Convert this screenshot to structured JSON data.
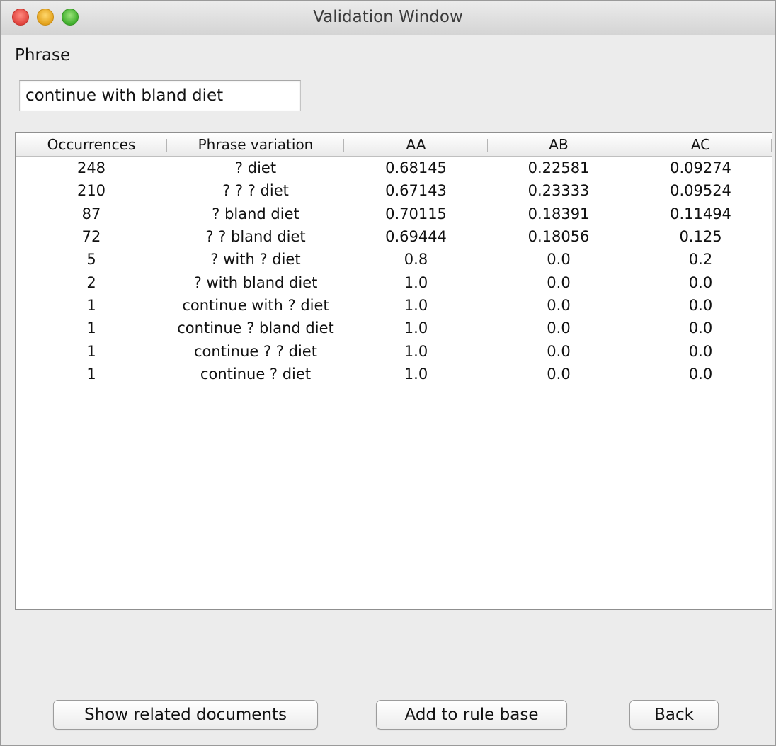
{
  "window": {
    "title": "Validation Window"
  },
  "phrase": {
    "label": "Phrase",
    "value": "continue with bland diet"
  },
  "table": {
    "columns": [
      "Occurrences",
      "Phrase variation",
      "AA",
      "AB",
      "AC"
    ],
    "rows": [
      [
        "248",
        "? diet",
        "0.68145",
        "0.22581",
        "0.09274"
      ],
      [
        "210",
        "? ? ? diet",
        "0.67143",
        "0.23333",
        "0.09524"
      ],
      [
        "87",
        "? bland diet",
        "0.70115",
        "0.18391",
        "0.11494"
      ],
      [
        "72",
        "? ? bland diet",
        "0.69444",
        "0.18056",
        "0.125"
      ],
      [
        "5",
        "? with ? diet",
        "0.8",
        "0.0",
        "0.2"
      ],
      [
        "2",
        "? with bland diet",
        "1.0",
        "0.0",
        "0.0"
      ],
      [
        "1",
        "continue with ? diet",
        "1.0",
        "0.0",
        "0.0"
      ],
      [
        "1",
        "continue ? bland diet",
        "1.0",
        "0.0",
        "0.0"
      ],
      [
        "1",
        "continue ? ? diet",
        "1.0",
        "0.0",
        "0.0"
      ],
      [
        "1",
        "continue ? diet",
        "1.0",
        "0.0",
        "0.0"
      ]
    ]
  },
  "buttons": {
    "related": "Show related documents",
    "add": "Add to rule base",
    "back": "Back"
  }
}
